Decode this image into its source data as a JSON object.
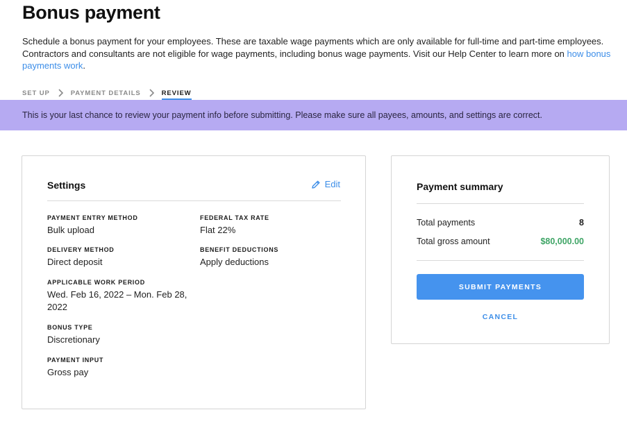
{
  "page": {
    "title": "Bonus payment",
    "intro_text": "Schedule a bonus payment for your employees. These are taxable wage payments which are only available for full-time and part-time employees. Contractors and consultants are not eligible for wage payments, including bonus wage payments. Visit our Help Center to learn more on ",
    "intro_link": "how bonus payments work",
    "intro_end": "."
  },
  "breadcrumb": {
    "steps": [
      "SET UP",
      "PAYMENT DETAILS",
      "REVIEW"
    ]
  },
  "banner": {
    "text": "This is your last chance to review your payment info before submitting. Please make sure all payees, amounts, and settings are correct."
  },
  "settings": {
    "title": "Settings",
    "edit_label": "Edit",
    "fields": [
      {
        "label": "PAYMENT ENTRY METHOD",
        "value": "Bulk upload"
      },
      {
        "label": "FEDERAL TAX RATE",
        "value": "Flat 22%"
      },
      {
        "label": "DELIVERY METHOD",
        "value": "Direct deposit"
      },
      {
        "label": "BENEFIT DEDUCTIONS",
        "value": "Apply deductions"
      },
      {
        "label": "APPLICABLE WORK PERIOD",
        "value": "Wed. Feb 16, 2022 – Mon. Feb 28, 2022"
      },
      {
        "label": "BONUS TYPE",
        "value": "Discretionary"
      },
      {
        "label": "PAYMENT INPUT",
        "value": "Gross pay"
      }
    ]
  },
  "summary": {
    "title": "Payment summary",
    "rows": [
      {
        "label": "Total payments",
        "value": "8"
      },
      {
        "label": "Total gross amount",
        "value": "$80,000.00"
      }
    ],
    "submit_label": "SUBMIT PAYMENTS",
    "cancel_label": "CANCEL",
    "accent_color": "#4593ee",
    "amount_color": "#3fa566"
  },
  "icons": {
    "breadcrumb_separator": "chevron-right-icon",
    "edit": "pencil-icon"
  }
}
